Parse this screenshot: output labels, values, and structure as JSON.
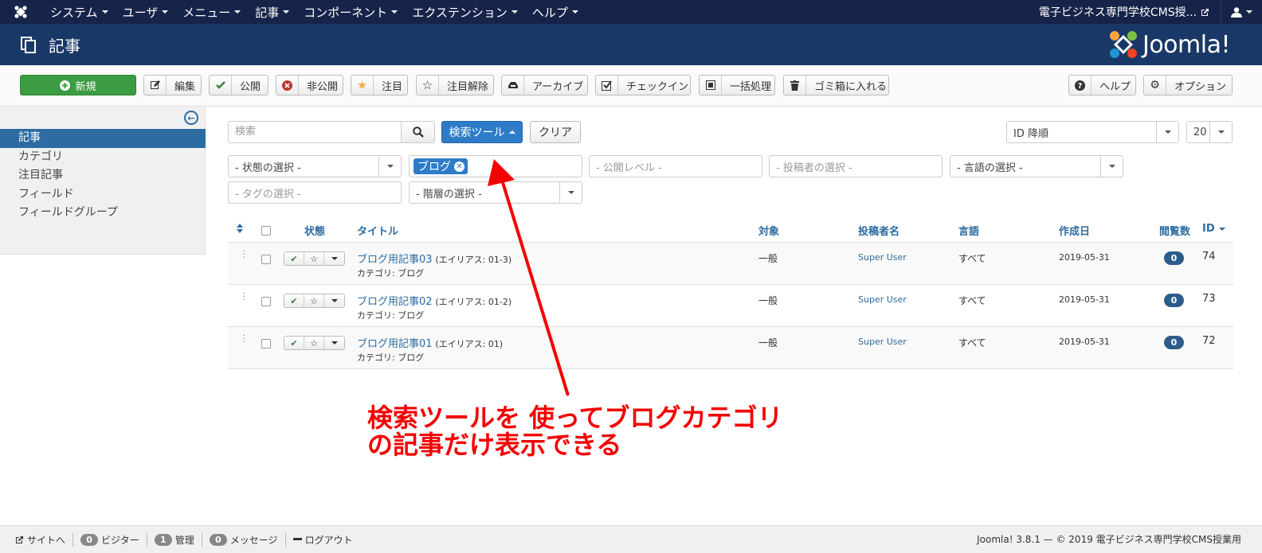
{
  "topnav": {
    "menus": [
      "システム",
      "ユーザ",
      "メニュー",
      "記事",
      "コンポーネント",
      "エクステンション",
      "ヘルプ"
    ],
    "site_name": "電子ビジネス専門学校CMS授..."
  },
  "header": {
    "title": "記事",
    "brand": "Joomla!"
  },
  "toolbar": {
    "new": "新規",
    "edit": "編集",
    "publish": "公開",
    "unpublish": "非公開",
    "feature": "注目",
    "unfeature": "注目解除",
    "archive": "アーカイブ",
    "checkin": "チェックイン",
    "batch": "一括処理",
    "trash": "ゴミ箱に入れる",
    "help": "ヘルプ",
    "options": "オプション"
  },
  "sidebar": {
    "items": [
      "記事",
      "カテゴリ",
      "注目記事",
      "フィールド",
      "フィールドグループ"
    ]
  },
  "filters": {
    "search_placeholder": "検索",
    "search_tools": "検索ツール",
    "clear": "クリア",
    "ordering": "ID 降順",
    "limit": "20",
    "status": "- 状態の選択 -",
    "category_chip": "ブログ",
    "access": "- 公開レベル -",
    "author": "- 投稿者の選択 -",
    "language": "- 言語の選択 -",
    "tag": "- タグの選択 -",
    "level": "- 階層の選択 -"
  },
  "table": {
    "headers": {
      "status": "状態",
      "title": "タイトル",
      "access": "対象",
      "author": "投稿者名",
      "language": "言語",
      "created": "作成日",
      "hits": "閲覧数",
      "id": "ID"
    },
    "rows": [
      {
        "title": "ブログ用記事03",
        "alias": "(エイリアス: 01-3)",
        "category": "カテゴリ: ブログ",
        "access": "一般",
        "author": "Super User",
        "language": "すべて",
        "created": "2019-05-31",
        "hits": "0",
        "id": "74"
      },
      {
        "title": "ブログ用記事02",
        "alias": "(エイリアス: 01-2)",
        "category": "カテゴリ: ブログ",
        "access": "一般",
        "author": "Super User",
        "language": "すべて",
        "created": "2019-05-31",
        "hits": "0",
        "id": "73"
      },
      {
        "title": "ブログ用記事01",
        "alias": "(エイリアス: 01)",
        "category": "カテゴリ: ブログ",
        "access": "一般",
        "author": "Super User",
        "language": "すべて",
        "created": "2019-05-31",
        "hits": "0",
        "id": "72"
      }
    ]
  },
  "annotation": {
    "line1": "検索ツールを 使ってブログカテゴリ",
    "line2": "の記事だけ表示できる",
    "color": "#f40000"
  },
  "footer": {
    "site_link": "サイトへ",
    "visitors_count": "0",
    "visitors": "ビジター",
    "admins_count": "1",
    "admins": "管理",
    "messages_count": "0",
    "messages": "メッセージ",
    "logout": "ログアウト",
    "copyright": "Joomla! 3.8.1 — © 2019 電子ビジネス専門学校CMS授業用"
  },
  "colors": {
    "topnav_bg": "#17244a",
    "header_bg": "#1a3867",
    "accent": "#2d6ca2",
    "new_button": "#3b9c43"
  }
}
